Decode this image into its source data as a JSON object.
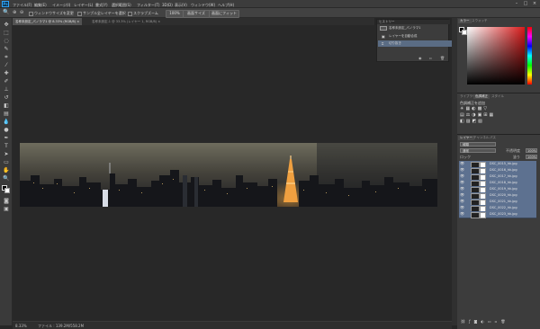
{
  "app": {
    "logo": "Ps",
    "menu": [
      "ファイル(F)",
      "編集(E)",
      "イメージ(I)",
      "レイヤー(L)",
      "書式(Y)",
      "選択範囲(S)",
      "フィルター(T)",
      "3D(D)",
      "表示(V)",
      "ウィンドウ(W)",
      "ヘルプ(H)"
    ],
    "window_controls": [
      "–",
      "□",
      "×"
    ]
  },
  "options_bar": {
    "sample_all_layers": "サンプル全レイヤーを選択",
    "auto_enhance": "ウィンドウサイズを変更",
    "scrub_zoom": "スクラブズーム",
    "zoom_100": "100%",
    "fit_screen": "画面サイズ",
    "fill_screen": "画面にフィット"
  },
  "document_tabs": [
    {
      "label": "名称未設定_パノラマ1 @ 8.33% (RGB/8) ×",
      "active": true
    },
    {
      "label": "名称未設定-1 @ 33.3% (レイヤー 1, RGB/8) ×",
      "active": false
    }
  ],
  "status_bar": {
    "zoom": "8.33%",
    "info": "ファイル : 139.2M/558.2M"
  },
  "history_panel": {
    "tabs": [
      "ヒストリー"
    ],
    "snapshot": "名称未設定_パノラマ1",
    "steps": [
      {
        "label": "レイヤーを自動合成",
        "selected": false
      },
      {
        "label": "切り抜き",
        "selected": true
      }
    ]
  },
  "color_panel": {
    "tabs": [
      "カラー",
      "スウォッチ"
    ],
    "accent_color": "#d91a1a"
  },
  "adjustments_panel": {
    "tabs": [
      "ライブラリ",
      "色調補正",
      "スタイル"
    ],
    "title": "色調補正を追加"
  },
  "layers_panel": {
    "tabs": [
      "レイヤー",
      "チャンネル",
      "パス"
    ],
    "filter_label": "種類",
    "blend_mode": "通常",
    "opacity_label": "不透明度",
    "opacity_value": "100%",
    "lock_label": "ロック",
    "fill_label": "塗り",
    "fill_value": "100%",
    "layers": [
      "DSC_0015_hk.jpg",
      "DSC_0016_hk.jpg",
      "DSC_0017_hk.jpg",
      "DSC_0018_hk.jpg",
      "DSC_0019_hk.jpg",
      "DSC_0020_hk.jpg",
      "DSC_0021_hk.jpg",
      "DSC_0022_hk.jpg",
      "DSC_0023_hk.jpg"
    ],
    "footer_icons": [
      "link-icon",
      "fx-icon",
      "mask-icon",
      "adjustment-icon",
      "folder-icon",
      "new-layer-icon",
      "trash-icon"
    ]
  }
}
